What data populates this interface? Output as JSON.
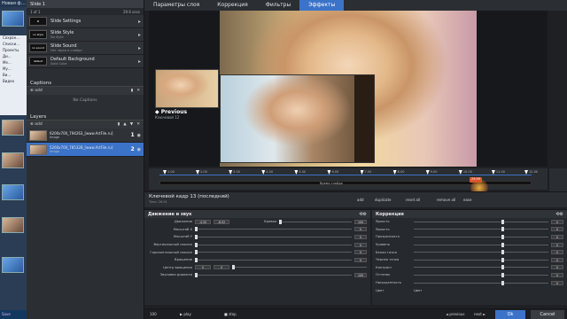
{
  "host": {
    "title": "Новая ф…",
    "tree": [
      "Сохран…",
      "Списки…",
      "Проекты",
      "Ди…",
      "Ме…",
      "Му…",
      "Ви…",
      "Видео"
    ],
    "status": "Save"
  },
  "slide_panel": {
    "header": "Slide 1",
    "sub_left": "1 of 1",
    "sub_right": "29.6 secs",
    "settings": [
      {
        "title": "Slide Settings",
        "sub": "",
        "icon": ""
      },
      {
        "title": "Slide Style",
        "sub": "No Style",
        "icon": "no style"
      },
      {
        "title": "Slide Sound",
        "sub": "Нет звука в слайде",
        "icon": "no sound"
      },
      {
        "title": "Default Background",
        "sub": "Solid Color",
        "icon": "default"
      }
    ],
    "captions": {
      "title": "Captions",
      "add": "add",
      "empty": "No Captions"
    },
    "layers": {
      "title": "Layers",
      "add": "add",
      "items": [
        {
          "name": "6200x700_794263_[www.ArtFile.ru]",
          "sub": "Image",
          "num": "1"
        },
        {
          "name": "5260x700_785328_[www.ArtFile.ru]",
          "sub": "Image",
          "num": "2"
        }
      ]
    }
  },
  "tabs": [
    "Параметры слоя",
    "Коррекция",
    "Фильтры",
    "Эффекты"
  ],
  "preview": {
    "prev_label": "◆ Previous",
    "prev_sub": "Ключевой 12"
  },
  "timeline": {
    "ticks": [
      "1.00",
      "2.00",
      "3.00",
      "4.00",
      "5.00",
      "6.00",
      "7.00",
      "8.00",
      "9.00",
      "10.00",
      "11.00",
      "12.00"
    ],
    "bar_label": "Время слайда",
    "cursor": "29.99"
  },
  "keyframe": {
    "title": "Ключевой кадр 13 (последний)",
    "sub": "Time: 26.91",
    "add": "add",
    "duplicate": "duplicate",
    "reset": "reset all",
    "remove": "remove all",
    "ease": "ease"
  },
  "motion": {
    "title": "Движение и звук",
    "rows": [
      {
        "label": "Движение",
        "v1": "-4.20",
        "v2": "-8.52",
        "extra": "Кривая",
        "v3": "100"
      },
      {
        "label": "Масштаб X",
        "v1": "",
        "v2": "",
        "extra": "",
        "v3": "0"
      },
      {
        "label": "Масштаб Y",
        "v1": "",
        "v2": "",
        "extra": "",
        "v3": "0"
      },
      {
        "label": "Вертикальный наклон",
        "v1": "",
        "v2": "",
        "extra": "",
        "v3": "0"
      },
      {
        "label": "Горизонтальный наклон",
        "v1": "",
        "v2": "",
        "extra": "",
        "v3": "0"
      },
      {
        "label": "Вращение",
        "v1": "",
        "v2": "",
        "extra": "",
        "v3": "0"
      },
      {
        "label": "Центр вращения",
        "v1": "0",
        "v2": "0",
        "extra": "",
        "v3": ""
      },
      {
        "label": "Звуковая дорожка",
        "v1": "",
        "v2": "",
        "extra": "",
        "v3": "100"
      }
    ]
  },
  "correction": {
    "title": "Коррекция",
    "rows": [
      {
        "label": "Яркость",
        "val": "0"
      },
      {
        "label": "Яркость",
        "val": "0"
      },
      {
        "label": "Прозрачность",
        "val": "0"
      },
      {
        "label": "Уровень",
        "val": "0"
      },
      {
        "label": "Белая точка",
        "val": "0"
      },
      {
        "label": "Черная точка",
        "val": "0"
      },
      {
        "label": "Контраст",
        "val": "0"
      },
      {
        "label": "Оттенок",
        "val": "0"
      },
      {
        "label": "Насыщенность",
        "val": "0"
      }
    ],
    "tint_label": "Цвет",
    "tint_label2": "Цвет"
  },
  "status": {
    "zoom": "100",
    "play": "play",
    "stop": "stop",
    "prev": "◄ previous",
    "next": "next ►",
    "ok": "Ok",
    "cancel": "Cancel"
  },
  "colors": {
    "accent": "#3b73c9",
    "marker": "#d9552c"
  }
}
